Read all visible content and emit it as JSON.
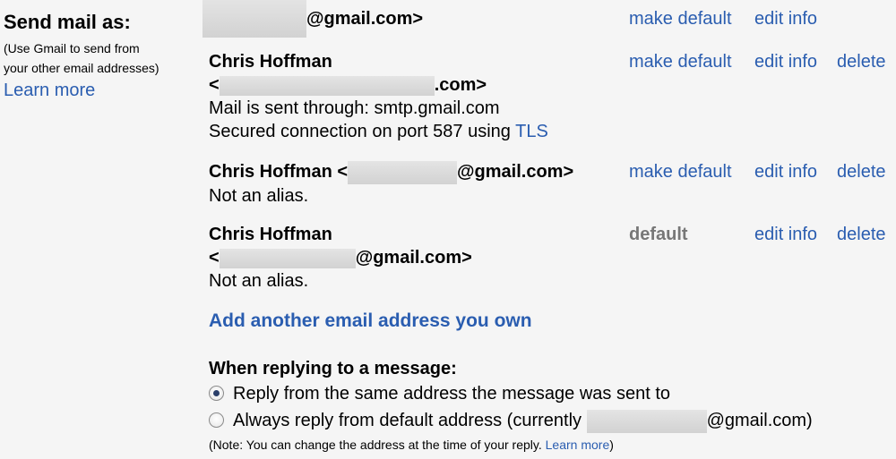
{
  "sidebar": {
    "title": "Send mail as:",
    "note_line1": "(Use Gmail to send from",
    "note_line2": "your other email addresses)",
    "learn_more": "Learn more"
  },
  "entries": [
    {
      "name": "",
      "address_suffix": "@gmail.com>",
      "actions": {
        "make_default": "make default",
        "edit_info": "edit info"
      }
    },
    {
      "name": "Chris Hoffman",
      "address_prefix": "<",
      "address_suffix": ".com>",
      "detail1": "Mail is sent through: smtp.gmail.com",
      "detail2_prefix": "Secured connection on port 587 using ",
      "detail2_link": "TLS",
      "actions": {
        "make_default": "make default",
        "edit_info": "edit info",
        "delete": "delete"
      }
    },
    {
      "name": "Chris Hoffman",
      "address_prefix": " <",
      "address_suffix": "@gmail.com>",
      "detail1": "Not an alias.",
      "actions": {
        "make_default": "make default",
        "edit_info": "edit info",
        "delete": "delete"
      }
    },
    {
      "name": "Chris Hoffman",
      "address_prefix": "<",
      "address_suffix": "@gmail.com>",
      "detail1": "Not an alias.",
      "actions": {
        "default": "default",
        "edit_info": "edit info",
        "delete": "delete"
      }
    }
  ],
  "add_address": "Add another email address you own",
  "reply": {
    "title": "When replying to a message:",
    "option1": "Reply from the same address the message was sent to",
    "option2_prefix": "Always reply from default address (currently ",
    "option2_suffix": "@gmail.com)",
    "selected": "option1",
    "note_prefix": "(Note: You can change the address at the time of your reply. ",
    "note_link": "Learn more",
    "note_suffix": ")"
  },
  "colors": {
    "link": "#2a5db0",
    "default_label": "#777777",
    "background": "#f5f5f5"
  }
}
